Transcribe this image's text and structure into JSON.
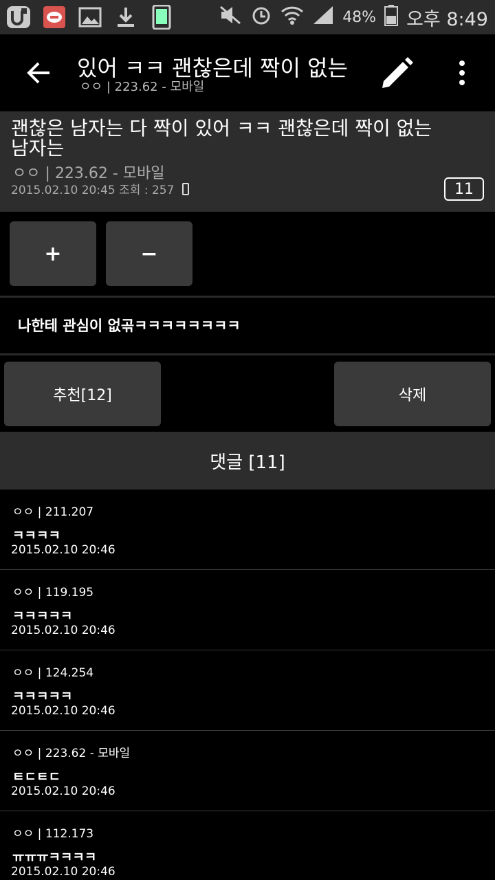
{
  "status_bar": {
    "battery": "48%",
    "time": "오후 8:49",
    "left_icons": [
      "u-plus-icon",
      "cafe-app-icon",
      "gallery-icon",
      "download-icon",
      "phone-screenshot-icon"
    ],
    "right_icons": [
      "mute-icon",
      "alarm-icon",
      "wifi-icon",
      "signal-icon",
      "battery-icon"
    ]
  },
  "appbar": {
    "title": "있어 ㅋㅋ 괜찮은데 짝이 없는",
    "subtitle": "ㅇㅇ | 223.62 - 모바일"
  },
  "post": {
    "title": "괜찮은 남자는 다 짝이 있어 ㅋㅋ 괜찮은데 짝이 없는 남자는",
    "author": "ㅇㅇ | 223.62 - 모바일",
    "meta": "2015.02.10 20:45 조회 : 257",
    "comment_count": "11",
    "content": "나한테 관심이 없곢ㅋㅋㅋㅋㅋㅋㅋㅋ"
  },
  "votes": {
    "plus": "+",
    "minus": "−"
  },
  "actions": {
    "recommend": "추천[12]",
    "delete": "삭제"
  },
  "comments_header": "댓글 [11]",
  "comments": [
    {
      "author": "ㅇㅇ | 211.207",
      "body": "ㅋㅋㅋㅋ",
      "date": "2015.02.10 20:46"
    },
    {
      "author": "ㅇㅇ | 119.195",
      "body": "ㅋㅋㅋㅋㅋ",
      "date": "2015.02.10 20:46"
    },
    {
      "author": "ㅇㅇ | 124.254",
      "body": "ㅋㅋㅋㅋㅋ",
      "date": "2015.02.10 20:46"
    },
    {
      "author": "ㅇㅇ | 223.62 - 모바일",
      "body": "ㅌㄷㅌㄷ",
      "date": "2015.02.10 20:46"
    },
    {
      "author": "ㅇㅇ | 112.173",
      "body": "ㅠㅠㅠㅋㅋㅋㅋ",
      "date": "2015.02.10 20:46"
    }
  ]
}
